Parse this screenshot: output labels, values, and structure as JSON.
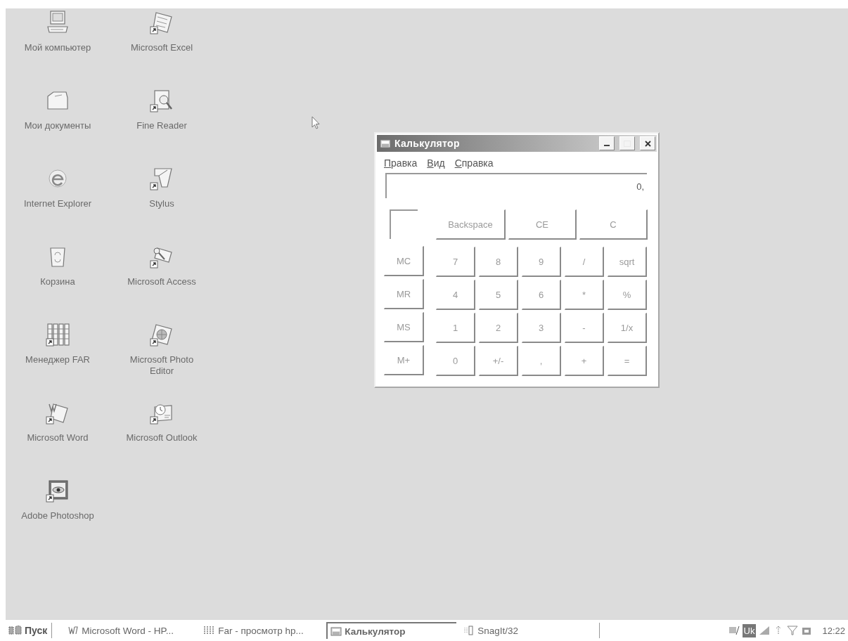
{
  "desktop": {
    "icons": [
      {
        "label": "Мой компьютер"
      },
      {
        "label": "Microsoft Excel"
      },
      {
        "label": "Мои документы"
      },
      {
        "label": "Fine Reader"
      },
      {
        "label": "Internet Explorer"
      },
      {
        "label": "Stylus"
      },
      {
        "label": "Корзина"
      },
      {
        "label": "Microsoft Access"
      },
      {
        "label": "Менеджер FAR"
      },
      {
        "label": "Microsoft Photo Editor"
      },
      {
        "label": "Microsoft Word"
      },
      {
        "label": "Microsoft Outlook"
      },
      {
        "label": "Adobe Photoshop"
      }
    ]
  },
  "calculator": {
    "title": "Калькулятор",
    "menu": [
      "Правка",
      "Вид",
      "Справка"
    ],
    "display": "0,",
    "top_buttons": [
      "Backspace",
      "CE",
      "C"
    ],
    "memory_buttons": [
      "MC",
      "MR",
      "MS",
      "M+"
    ],
    "keypad": [
      [
        "7",
        "8",
        "9",
        "/",
        "sqrt"
      ],
      [
        "4",
        "5",
        "6",
        "*",
        "%"
      ],
      [
        "1",
        "2",
        "3",
        "-",
        "1/x"
      ],
      [
        "0",
        "+/-",
        ",",
        "+",
        "="
      ]
    ]
  },
  "taskbar": {
    "start": "Пуск",
    "tasks": [
      {
        "label": "Microsoft Word - HP...",
        "selected": false
      },
      {
        "label": "Far - просмотр hp...",
        "selected": false
      },
      {
        "label": "Калькулятор",
        "selected": true
      },
      {
        "label": "SnagIt/32",
        "selected": false
      }
    ],
    "tray": {
      "language": "Uk",
      "time": "12:22"
    }
  }
}
